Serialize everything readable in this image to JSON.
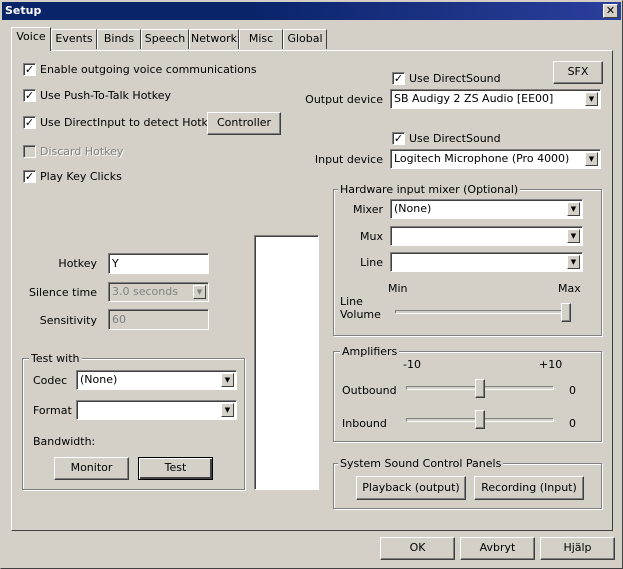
{
  "window": {
    "title": "Setup",
    "close_glyph": "✕"
  },
  "tabs": [
    {
      "label": "Voice",
      "active": true
    },
    {
      "label": "Events"
    },
    {
      "label": "Binds"
    },
    {
      "label": "Speech"
    },
    {
      "label": "Network"
    },
    {
      "label": "Misc"
    },
    {
      "label": "Global"
    }
  ],
  "options": {
    "enable_outgoing": {
      "label": "Enable outgoing voice communications",
      "checked": true
    },
    "push_to_talk": {
      "label": "Use Push-To-Talk Hotkey",
      "checked": true
    },
    "directinput": {
      "label": "Use DirectInput to detect Hotkey",
      "checked": true
    },
    "discard_hotkey": {
      "label": "Discard Hotkey",
      "checked": false,
      "disabled": true
    },
    "play_key_clicks": {
      "label": "Play Key Clicks",
      "checked": true
    },
    "controller_button": "Controller"
  },
  "hotkey": {
    "hotkey_label": "Hotkey",
    "hotkey_value": "Y",
    "silence_label": "Silence time",
    "silence_value": "3.0 seconds",
    "sensitivity_label": "Sensitivity",
    "sensitivity_value": "60"
  },
  "test_with": {
    "title": "Test with",
    "codec_label": "Codec",
    "codec_value": "(None)",
    "format_label": "Format",
    "format_value": "",
    "bandwidth_label": "Bandwidth:",
    "monitor_button": "Monitor",
    "test_button": "Test"
  },
  "output": {
    "directsound_label": "Use DirectSound",
    "directsound_checked": true,
    "sfx_button": "SFX",
    "device_label": "Output device",
    "device_value": "SB Audigy 2 ZS Audio [EE00]"
  },
  "input": {
    "directsound_label": "Use DirectSound",
    "directsound_checked": true,
    "device_label": "Input device",
    "device_value": "Logitech Microphone (Pro 4000)"
  },
  "mixer": {
    "title": "Hardware input mixer (Optional)",
    "mixer_label": "Mixer",
    "mixer_value": "(None)",
    "mux_label": "Mux",
    "mux_value": "",
    "line_label": "Line",
    "line_value": "",
    "min_label": "Min",
    "max_label": "Max",
    "volume_label_1": "Line",
    "volume_label_2": "Volume",
    "volume_level": 1.0
  },
  "amplifiers": {
    "title": "Amplifiers",
    "min_label": "-10",
    "max_label": "+10",
    "outbound_label": "Outbound",
    "outbound_value": "0",
    "outbound_level": 0.5,
    "inbound_label": "Inbound",
    "inbound_value": "0",
    "inbound_level": 0.5
  },
  "sound_panels": {
    "title": "System Sound Control Panels",
    "playback_button": "Playback (output)",
    "recording_button": "Recording (Input)"
  },
  "footer": {
    "ok": "OK",
    "cancel": "Avbryt",
    "help": "Hjälp"
  }
}
